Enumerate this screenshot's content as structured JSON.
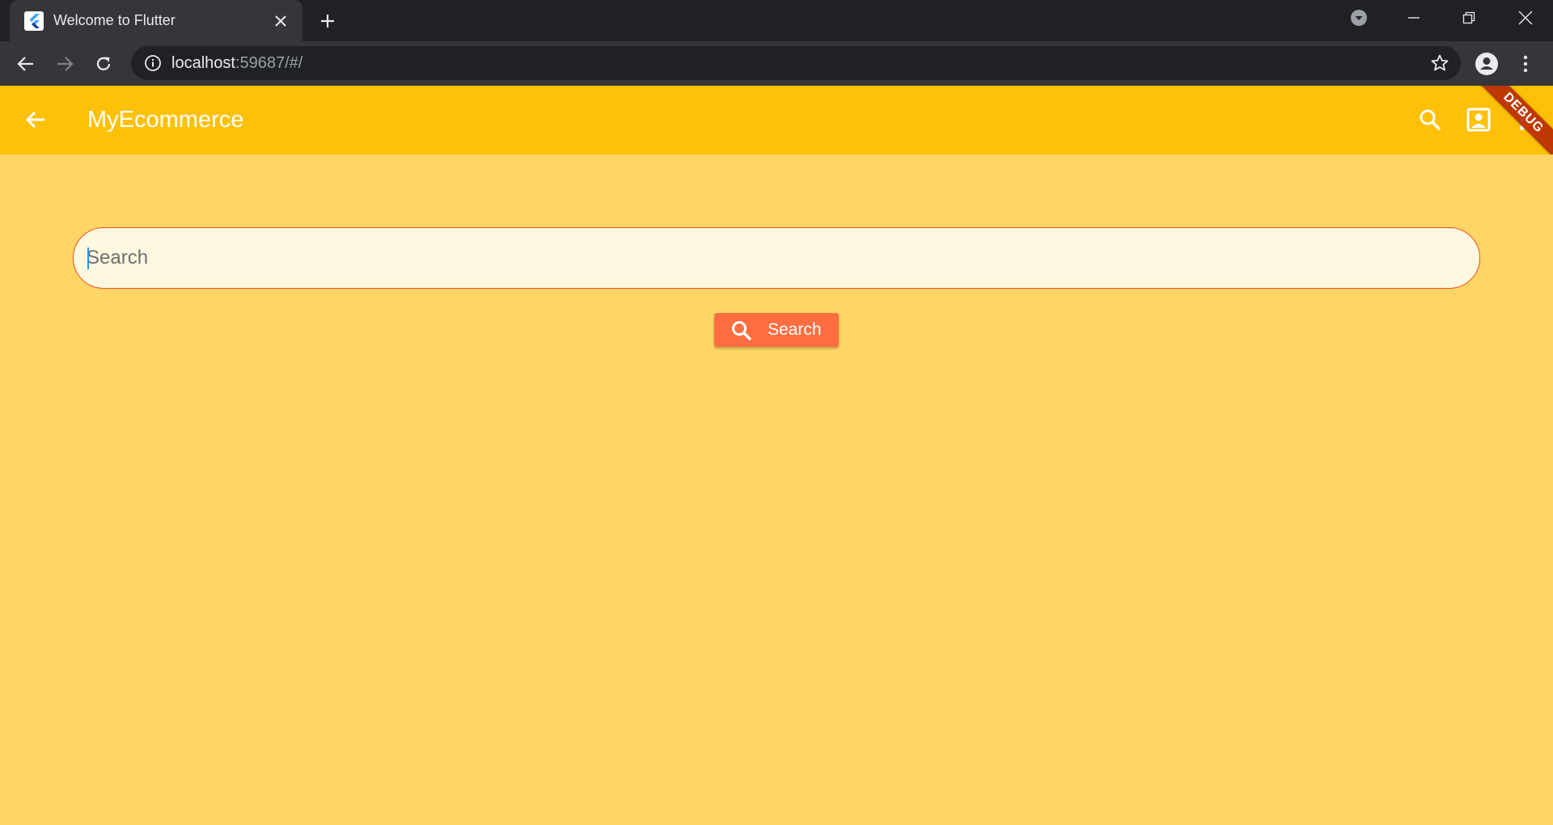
{
  "browser": {
    "tab": {
      "title": "Welcome to Flutter",
      "favicon": "flutter-logo-icon"
    },
    "new_tab_icon": "plus-icon",
    "address": {
      "host": "localhost",
      "rest": ":59687/#/"
    },
    "icons": [
      "back-arrow-icon",
      "forward-arrow-icon",
      "reload-icon",
      "info-icon",
      "star-icon",
      "profile-icon",
      "kebab-menu-icon",
      "minimize-icon",
      "restore-icon",
      "close-icon",
      "tab-search-icon"
    ]
  },
  "app": {
    "title": "MyEcommerce",
    "colors": {
      "appbar": "#ffc107",
      "background": "#ffd666",
      "accent": "#ff6e40",
      "border": "#f4511e"
    },
    "actions": [
      "search-icon",
      "account-box-icon",
      "more-vert-icon"
    ],
    "debug_banner": "DEBUG",
    "search": {
      "placeholder": "Search",
      "value": ""
    },
    "search_button": {
      "label": "Search",
      "icon": "search-icon"
    }
  }
}
